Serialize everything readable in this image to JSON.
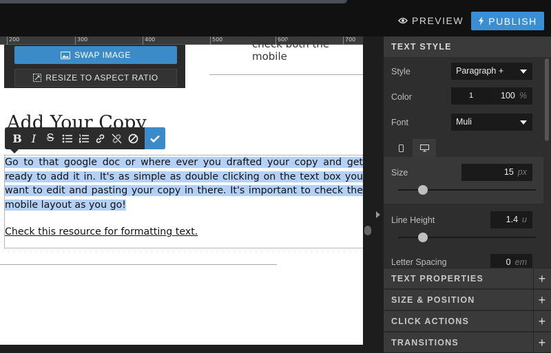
{
  "header": {
    "preview_label": "PREVIEW",
    "publish_label": "PUBLISH"
  },
  "ruler": {
    "ticks": [
      "200",
      "300",
      "400",
      "500",
      "600",
      "700"
    ]
  },
  "image_tools": {
    "swap_label": "SWAP IMAGE",
    "resize_label": "RESIZE TO ASPECT RATIO"
  },
  "canvas": {
    "mobile_snippet": "check both the mobile",
    "heading": "Add Your Copy",
    "body": "Go to that google doc or where ever you drafted your copy and get ready to add it in. It's as simple as double clicking on the text box you want to edit and pasting your copy in there. It's important to check the mobile layout as you go!",
    "link": "Check this resource for formatting text. "
  },
  "format_toolbar": {
    "bold": "B",
    "italic": "I",
    "strike": "S"
  },
  "panel": {
    "title": "TEXT STYLE",
    "style_label": "Style",
    "style_value": "Paragraph +",
    "color_label": "Color",
    "color_swatch": "1",
    "color_opacity": "100",
    "color_unit": "%",
    "font_label": "Font",
    "font_value": "Muli",
    "size_label": "Size",
    "size_value": "15",
    "size_unit": "px",
    "size_fraction": 0.18,
    "line_height_label": "Line Height",
    "line_height_value": "1.4",
    "line_height_unit": "u",
    "line_height_fraction": 0.18,
    "letter_spacing_label": "Letter Spacing",
    "letter_spacing_value": "0",
    "letter_spacing_unit": "em",
    "sections": [
      "TEXT PROPERTIES",
      "SIZE & POSITION",
      "CLICK ACTIONS",
      "TRANSITIONS"
    ]
  },
  "colors": {
    "accent": "#3a8fd4",
    "selection": "#b3d1f7",
    "panel_bg": "#2e2e2e"
  }
}
